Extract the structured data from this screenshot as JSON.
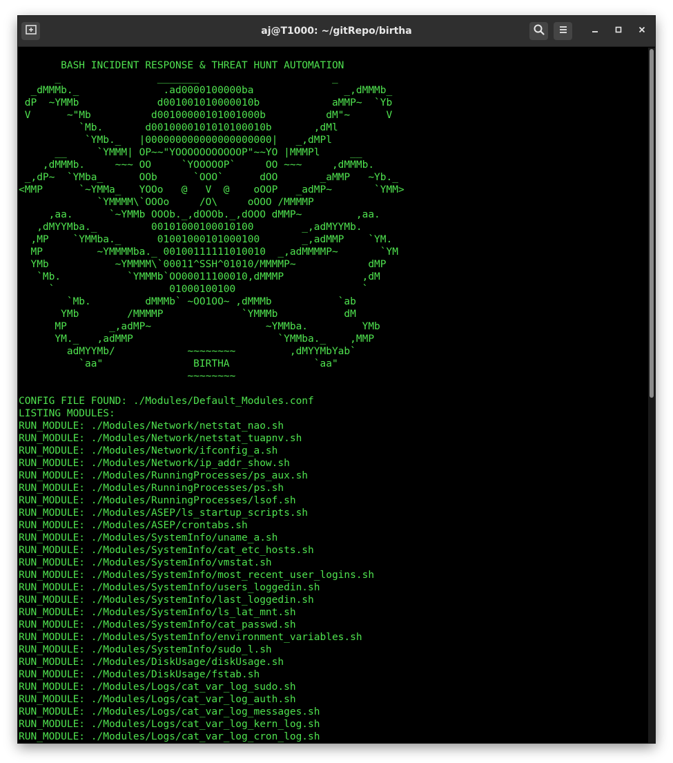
{
  "window": {
    "title": "aj@T1000: ~/gitRepo/birtha"
  },
  "icons": {
    "new_tab": "new-tab-icon",
    "search": "search-icon",
    "menu": "hamburger-menu-icon",
    "minimize": "minimize-icon",
    "maximize": "maximize-icon",
    "close": "close-icon"
  },
  "colors": {
    "terminal_text": "#4fe24f",
    "terminal_bg": "#000000",
    "titlebar_bg": "#2f2f2f"
  },
  "terminal": {
    "banner": "       BASH INCIDENT RESPONSE & THREAT HUNT AUTOMATION\n      _                _______                      _\n  _dMMMb._              .ad0000100000ba               _,dMMMb_\n dP  ~YMMb             d001001010000010b            aMMP~  `Yb\n V      ~\"Mb          d00100000101001000b          dM\"~      V\n          `Mb.       d0010000101010100010b       ,dMl\n           `YMb._   |000000000000000000000|   _,dMPl\n      __     `YMMM| OP~~\"YOOOOOOOOOOOP\"~~YO |MMMPl     __\n    ,dMMMb.     ~~~ OO     `YOOOOOP`     OO ~~~     ,dMMMb.\n _,dP~  `YMba_      OOb      `OOO`      dOO       _aMMP   ~Yb._\n<MMP      `~YMMa_   YOOo   @   V  @    oOOP   _adMP~       `YMM>\n             `YMMMM\\`OOOo     /O\\     oOOO /MMMMP\n     ,aa.      `~YMMb OOOb._,dOOOb._,dOOO dMMP~         ,aa.\n   ,dMYYMba._         00101000100010100        _,adMYYMb.\n  ,MP    `YMMba._      01001000101000100       _,adMMP    `YM.\n  MP         ~YMMMMba._ 00100111111010010  _,adMMMMP~       `YM\n  YMb           ~YMMMM\\`00011^SSH^01010/MMMMP~            dMP\n   `Mb.           `YMMMb`OO00011100010,dMMMP             ,dM\n     `                   01000100100                     `\n        `Mb.         dMMMb` ~OO1OO~ ,dMMMb           `ab\n       YMb        /MMMMP             `YMMMb           dM\n      MP       _,adMP~                   ~YMMba.         YMb\n      YM._   ,adMMP                        `YMMba._    ,MMP\n        adMYYMb/            ~~~~~~~~         ,dMYYMbYab`\n          `aa\"               BIRTHA              `aa\"\n                            ~~~~~~~~",
    "output_lines": [
      "CONFIG FILE FOUND: ./Modules/Default_Modules.conf",
      "LISTING MODULES:",
      "RUN_MODULE: ./Modules/Network/netstat_nao.sh",
      "RUN_MODULE: ./Modules/Network/netstat_tuapnv.sh",
      "RUN_MODULE: ./Modules/Network/ifconfig_a.sh",
      "RUN_MODULE: ./Modules/Network/ip_addr_show.sh",
      "RUN_MODULE: ./Modules/RunningProcesses/ps_aux.sh",
      "RUN_MODULE: ./Modules/RunningProcesses/ps.sh",
      "RUN_MODULE: ./Modules/RunningProcesses/lsof.sh",
      "RUN_MODULE: ./Modules/ASEP/ls_startup_scripts.sh",
      "RUN_MODULE: ./Modules/ASEP/crontabs.sh",
      "RUN_MODULE: ./Modules/SystemInfo/uname_a.sh",
      "RUN_MODULE: ./Modules/SystemInfo/cat_etc_hosts.sh",
      "RUN_MODULE: ./Modules/SystemInfo/vmstat.sh",
      "RUN_MODULE: ./Modules/SystemInfo/most_recent_user_logins.sh",
      "RUN_MODULE: ./Modules/SystemInfo/users_loggedin.sh",
      "RUN_MODULE: ./Modules/SystemInfo/last_loggedin.sh",
      "RUN_MODULE: ./Modules/SystemInfo/ls_lat_mnt.sh",
      "RUN_MODULE: ./Modules/SystemInfo/cat_passwd.sh",
      "RUN_MODULE: ./Modules/SystemInfo/environment_variables.sh",
      "RUN_MODULE: ./Modules/SystemInfo/sudo_l.sh",
      "RUN_MODULE: ./Modules/DiskUsage/diskUsage.sh",
      "RUN_MODULE: ./Modules/DiskUsage/fstab.sh",
      "RUN_MODULE: ./Modules/Logs/cat_var_log_sudo.sh",
      "RUN_MODULE: ./Modules/Logs/cat_var_log_auth.sh",
      "RUN_MODULE: ./Modules/Logs/cat_var_log_messages.sh",
      "RUN_MODULE: ./Modules/Logs/cat_var_log_kern_log.sh",
      "RUN_MODULE: ./Modules/Logs/cat_var_log_cron_log.sh"
    ]
  }
}
